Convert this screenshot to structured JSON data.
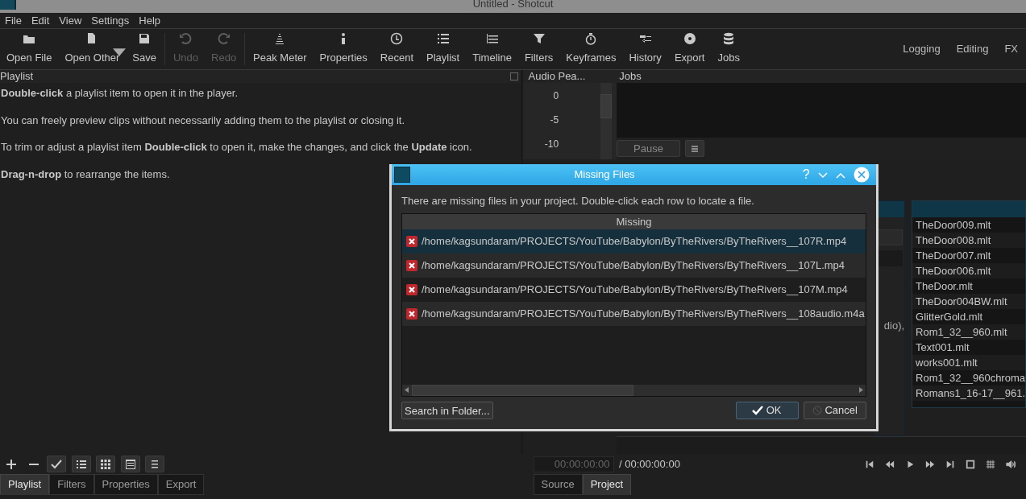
{
  "window": {
    "title": "Untitled - Shotcut"
  },
  "menu": [
    "File",
    "Edit",
    "View",
    "Settings",
    "Help"
  ],
  "toolbar_groups": [
    [
      {
        "label": "Open File",
        "disabled": false,
        "dropdown": false
      },
      {
        "label": "Open Other",
        "disabled": false,
        "dropdown": true
      },
      {
        "label": "Save",
        "disabled": false,
        "dropdown": false
      }
    ],
    [
      {
        "label": "Undo",
        "disabled": true,
        "dropdown": false
      },
      {
        "label": "Redo",
        "disabled": true,
        "dropdown": false
      }
    ],
    [
      {
        "label": "Peak Meter",
        "disabled": false,
        "dropdown": false
      },
      {
        "label": "Properties",
        "disabled": false,
        "dropdown": false
      },
      {
        "label": "Recent",
        "disabled": false,
        "dropdown": false
      },
      {
        "label": "Playlist",
        "disabled": false,
        "dropdown": false
      },
      {
        "label": "Timeline",
        "disabled": false,
        "dropdown": false
      },
      {
        "label": "Filters",
        "disabled": false,
        "dropdown": false
      },
      {
        "label": "Keyframes",
        "disabled": false,
        "dropdown": false
      },
      {
        "label": "History",
        "disabled": false,
        "dropdown": false
      },
      {
        "label": "Export",
        "disabled": false,
        "dropdown": false
      },
      {
        "label": "Jobs",
        "disabled": false,
        "dropdown": false
      }
    ]
  ],
  "layouts": [
    "Logging",
    "Editing",
    "FX"
  ],
  "playlist": {
    "title": "Playlist",
    "paragraphs": [
      "**Double-click** a playlist item to open it in the player.",
      "You can freely preview clips without necessarily adding them to the playlist or closing it.",
      "To trim or adjust a playlist item **Double-click** to open it, make the changes, and click the **Update** icon.",
      "**Drag-n-drop** to rearrange the items."
    ]
  },
  "audio_peak": {
    "title": "Audio Pea...",
    "scale": [
      "0",
      "-5",
      "-10"
    ]
  },
  "jobs": {
    "title": "Jobs",
    "pause": "Pause",
    "side_text": "dio),",
    "files": [
      "TheDoor009.mlt",
      "TheDoor008.mlt",
      "TheDoor007.mlt",
      "TheDoor006.mlt",
      "TheDoor.mlt",
      "TheDoor004BW.mlt",
      "GlitterGold.mlt",
      "Rom1_32__960.mlt",
      "Text001.mlt",
      "works001.mlt",
      "Rom1_32__960chroma",
      "Romans1_16-17__961."
    ]
  },
  "dialog": {
    "title": "Missing Files",
    "message": "There are missing files in your project. Double-click each row to locate a file.",
    "column": "Missing",
    "rows": [
      {
        "path": "/home/kagsundaram/PROJECTS/YouTube/Babylon/ByTheRivers/ByTheRivers__107R.mp4",
        "selected": true
      },
      {
        "path": "/home/kagsundaram/PROJECTS/YouTube/Babylon/ByTheRivers/ByTheRivers__107L.mp4",
        "selected": false
      },
      {
        "path": "/home/kagsundaram/PROJECTS/YouTube/Babylon/ByTheRivers/ByTheRivers__107M.mp4",
        "selected": false
      },
      {
        "path": "/home/kagsundaram/PROJECTS/YouTube/Babylon/ByTheRivers/ByTheRivers__108audio.m4a",
        "selected": false
      }
    ],
    "help": "?",
    "search_button": "Search in Folder...",
    "ok": "OK",
    "cancel": "Cancel"
  },
  "left_tabs": [
    {
      "label": "Playlist",
      "selected": true
    },
    {
      "label": "Filters",
      "selected": false
    },
    {
      "label": "Properties",
      "selected": false
    },
    {
      "label": "Export",
      "selected": false
    }
  ],
  "player": {
    "timecode": "00:00:00:00",
    "duration": "/ 00:00:00:00"
  },
  "right_tabs": [
    {
      "label": "Source",
      "selected": false
    },
    {
      "label": "Project",
      "selected": true
    }
  ]
}
